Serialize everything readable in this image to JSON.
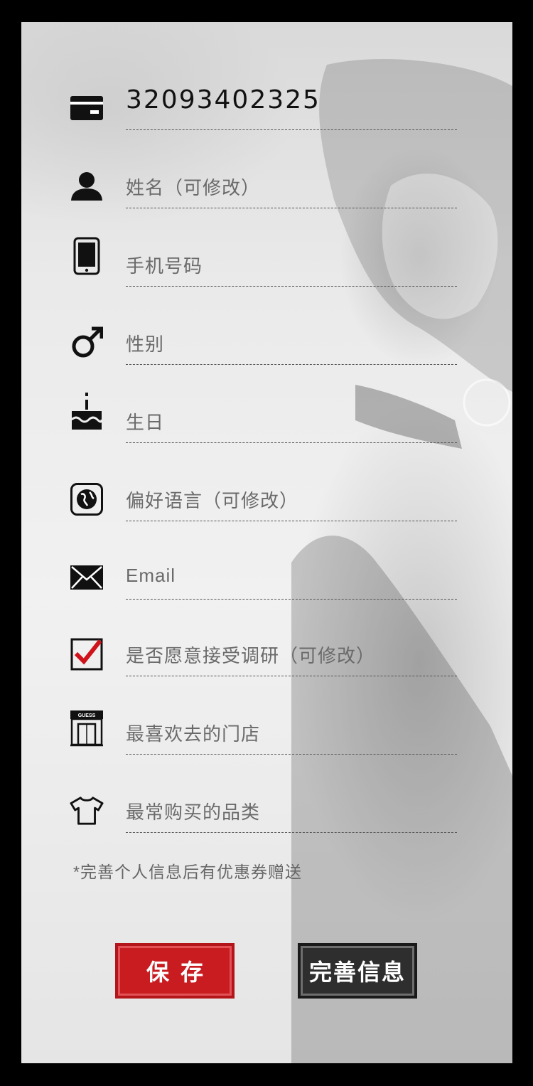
{
  "colors": {
    "accent_red": "#c81c21",
    "dark_button": "#2e2e2e",
    "text_gray": "#6a6a6a"
  },
  "form": {
    "card_number": "32093402325",
    "rows": [
      {
        "icon": "card-icon",
        "label": "32093402325"
      },
      {
        "icon": "person-icon",
        "label": "姓名（可修改）"
      },
      {
        "icon": "phone-icon",
        "label": "手机号码"
      },
      {
        "icon": "male-icon",
        "label": "性别"
      },
      {
        "icon": "birthday-cake-icon",
        "label": "生日"
      },
      {
        "icon": "globe-icon",
        "label": "偏好语言（可修改）"
      },
      {
        "icon": "envelope-icon",
        "label": "Email"
      },
      {
        "icon": "checkbox-checked-icon",
        "label": "是否愿意接受调研（可修改）"
      },
      {
        "icon": "store-icon",
        "label": "最喜欢去的门店",
        "icon_text": "GUESS"
      },
      {
        "icon": "tshirt-icon",
        "label": "最常购买的品类"
      }
    ]
  },
  "note": "*完善个人信息后有优惠券赠送",
  "buttons": {
    "save": "保存",
    "complete": "完善信息"
  }
}
